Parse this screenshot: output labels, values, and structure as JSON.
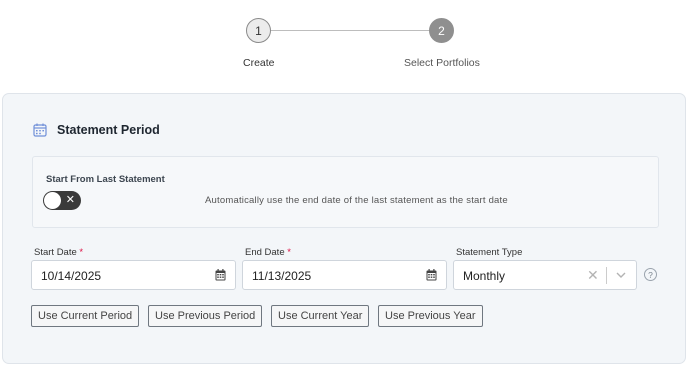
{
  "stepper": {
    "steps": [
      {
        "number": "1",
        "label": "Create"
      },
      {
        "number": "2",
        "label": "Select Portfolios"
      }
    ]
  },
  "section": {
    "icon": "calendar-icon",
    "title": "Statement Period"
  },
  "toggle": {
    "title": "Start From Last Statement",
    "state": "off",
    "description": "Automatically use the end date of the last statement as the start date"
  },
  "fields": {
    "start_date": {
      "label": "Start Date",
      "required_mark": "*",
      "value": "10/14/2025",
      "icon": "calendar-icon"
    },
    "end_date": {
      "label": "End Date",
      "required_mark": "*",
      "value": "11/13/2025",
      "icon": "calendar-icon"
    },
    "statement_type": {
      "label": "Statement Type",
      "value": "Monthly",
      "clear_icon": "close-icon",
      "dropdown_icon": "chevron-down-icon"
    },
    "help_icon": "?"
  },
  "buttons": {
    "current_period": "Use Current Period",
    "previous_period": "Use Previous Period",
    "current_year": "Use Current Year",
    "previous_year": "Use Previous Year"
  },
  "colors": {
    "accent": "#6f8fd8",
    "panel_bg": "#f3f6f9",
    "toggle_bg": "#3a3a3a",
    "step_active_bg": "#8f8f8f",
    "required": "#dd1144"
  }
}
